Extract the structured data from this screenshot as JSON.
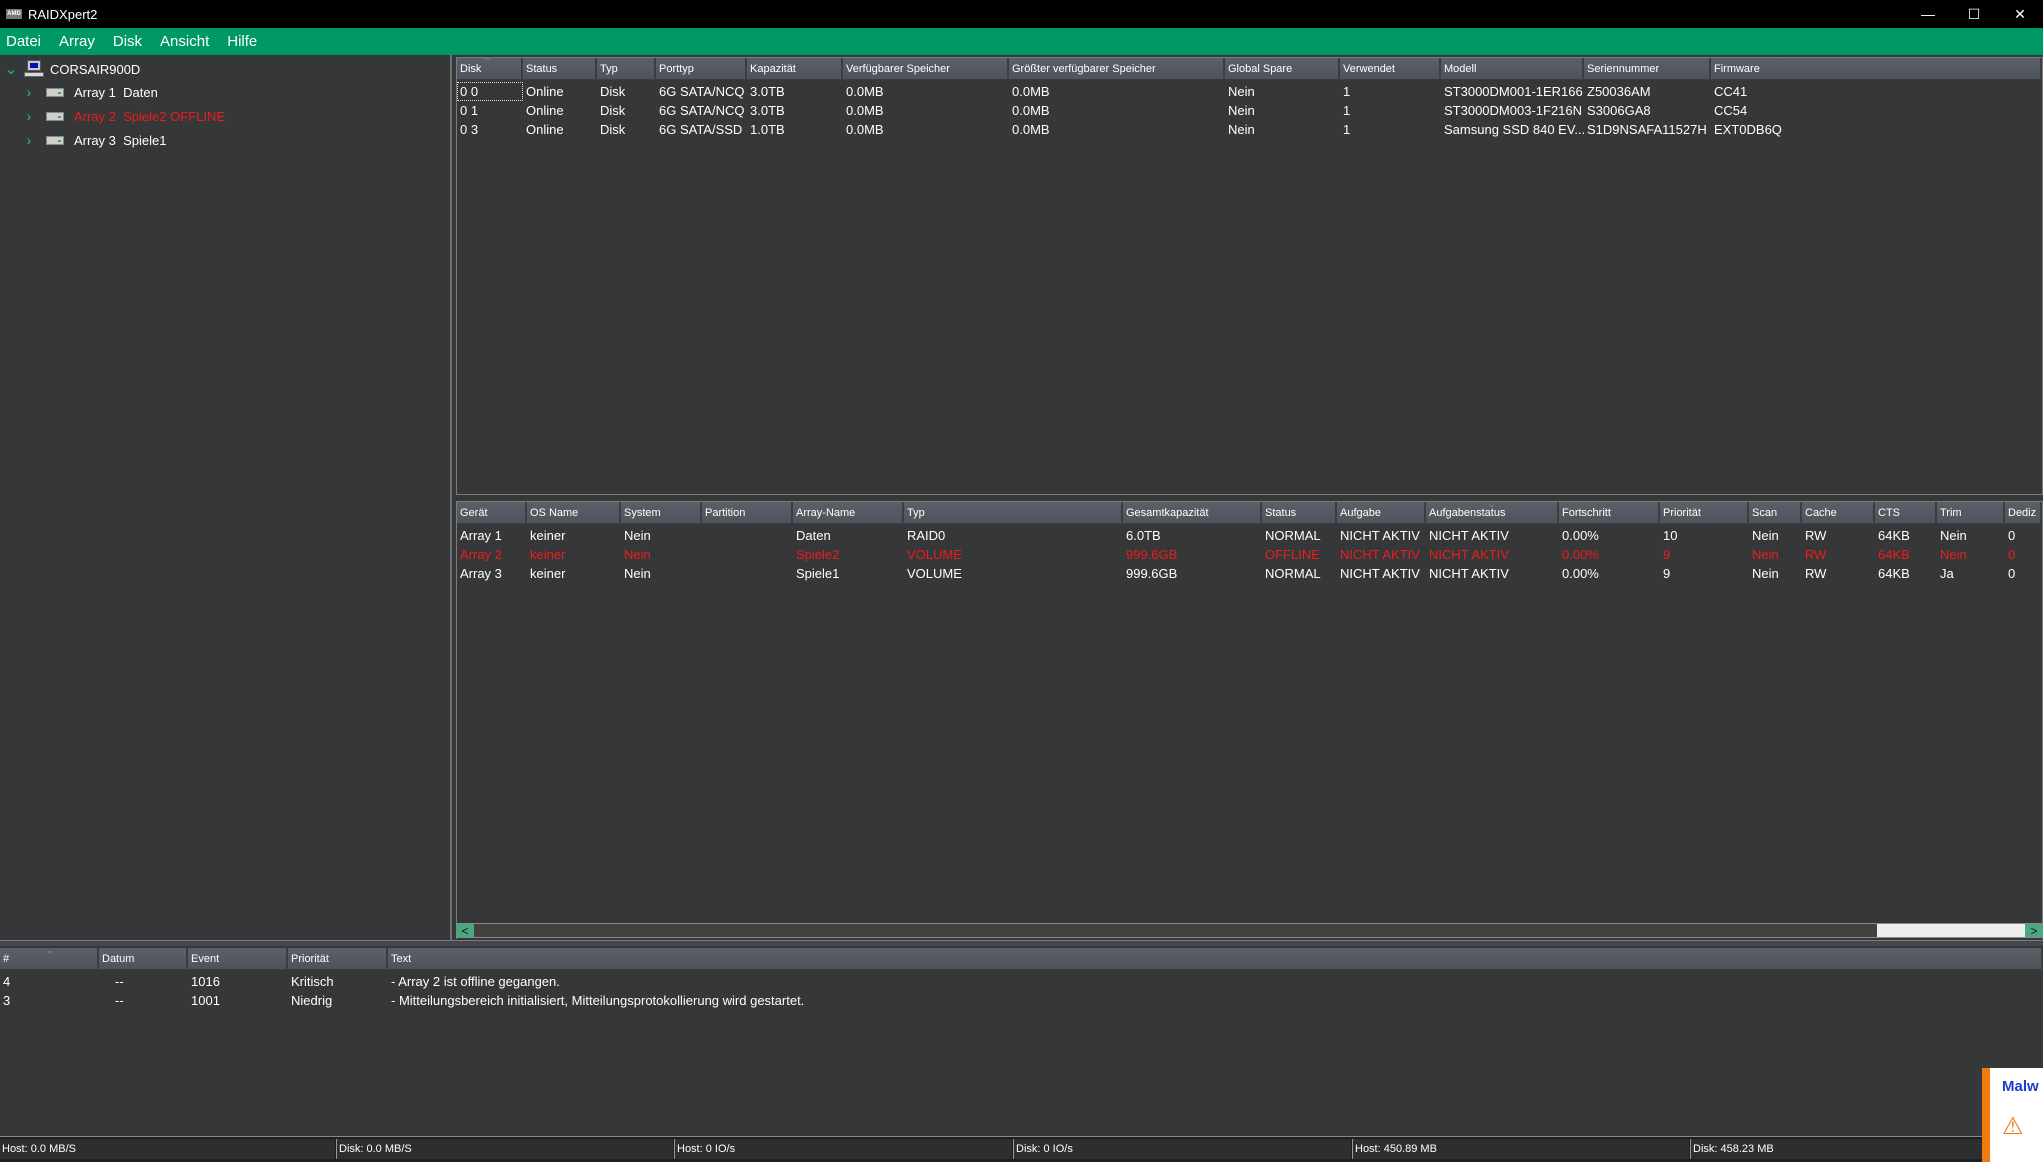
{
  "window": {
    "logo": "AMD",
    "title": "RAIDXpert2",
    "controls": {
      "minimize": "—",
      "maximize": "☐",
      "close": "✕"
    }
  },
  "menu": [
    "Datei",
    "Array",
    "Disk",
    "Ansicht",
    "Hilfe"
  ],
  "tree": {
    "root": {
      "label": "CORSAIR900D",
      "icon": "computer-icon",
      "expanded": true
    },
    "children": [
      {
        "label": "Array 1  Daten",
        "icon": "drive-icon",
        "state": "normal"
      },
      {
        "label": "Array 2  Spiele2 OFFLINE",
        "icon": "drive-icon",
        "state": "offline"
      },
      {
        "label": "Array 3  Spiele1",
        "icon": "drive-icon",
        "state": "normal"
      }
    ]
  },
  "colors": {
    "accent": "#009966",
    "error": "#ee1c1c",
    "background": "#363739",
    "header": "#545962",
    "toast_accent": "#f07a10"
  },
  "disk_table": {
    "columns": [
      "Disk",
      "Status",
      "Typ",
      "Porttyp",
      "Kapazität",
      "Verfügbarer Speicher",
      "Größter verfügbarer Speicher",
      "Global Spare",
      "Verwendet",
      "Modell",
      "Seriennummer",
      "Firmware"
    ],
    "rows": [
      [
        "0 0",
        "Online",
        "Disk",
        "6G SATA/NCQ",
        "3.0TB",
        "0.0MB",
        "0.0MB",
        "Nein",
        "1",
        "ST3000DM001-1ER166",
        "Z50036AM",
        "CC41"
      ],
      [
        "0 1",
        "Online",
        "Disk",
        "6G SATA/NCQ",
        "3.0TB",
        "0.0MB",
        "0.0MB",
        "Nein",
        "1",
        "ST3000DM003-1F216N",
        "S3006GA8",
        "CC54"
      ],
      [
        "0 3",
        "Online",
        "Disk",
        "6G SATA/SSD",
        "1.0TB",
        "0.0MB",
        "0.0MB",
        "Nein",
        "1",
        "Samsung SSD 840 EV...",
        "S1D9NSAFA11527H",
        "EXT0DB6Q"
      ]
    ]
  },
  "array_table": {
    "columns": [
      "Gerät",
      "OS Name",
      "System",
      "Partition",
      "Array-Name",
      "Typ",
      "Gesamtkapazität",
      "Status",
      "Aufgabe",
      "Aufgabenstatus",
      "Fortschritt",
      "Priorität",
      "Scan",
      "Cache",
      "CTS",
      "Trim",
      "Dediz"
    ],
    "rows": [
      {
        "state": "normal",
        "cells": [
          "Array 1",
          "keiner",
          "Nein",
          "",
          "Daten",
          "RAID0",
          "6.0TB",
          "NORMAL",
          "NICHT AKTIV",
          "NICHT AKTIV",
          "0.00%",
          "10",
          "Nein",
          "RW",
          "64KB",
          "Nein",
          "0"
        ]
      },
      {
        "state": "offline",
        "cells": [
          "Array 2",
          "keiner",
          "Nein",
          "",
          "Spiele2",
          "VOLUME",
          "999.6GB",
          "OFFLINE",
          "NICHT AKTIV",
          "NICHT AKTIV",
          "0.00%",
          "9",
          "Nein",
          "RW",
          "64KB",
          "Nein",
          "0"
        ]
      },
      {
        "state": "normal",
        "cells": [
          "Array 3",
          "keiner",
          "Nein",
          "",
          "Spiele1",
          "VOLUME",
          "999.6GB",
          "NORMAL",
          "NICHT AKTIV",
          "NICHT AKTIV",
          "0.00%",
          "9",
          "Nein",
          "RW",
          "64KB",
          "Ja",
          "0"
        ]
      }
    ],
    "scroll": {
      "left": "<",
      "right": ">"
    }
  },
  "event_log": {
    "columns": [
      "#",
      "Datum",
      "Event",
      "Priorität",
      "Text"
    ],
    "rows": [
      [
        "4",
        "--",
        "1016",
        "Kritisch",
        "- Array 2 ist offline gegangen."
      ],
      [
        "3",
        "--",
        "1001",
        "Niedrig",
        "- Mitteilungsbereich initialisiert, Mitteilungsprotokollierung wird gestartet."
      ]
    ]
  },
  "statusbar": [
    "Host: 0.0 MB/S",
    "Disk: 0.0 MB/S",
    "Host: 0 IO/s",
    "Disk: 0 IO/s",
    "Host: 450.89 MB",
    "Disk: 458.23 MB"
  ],
  "toast": {
    "brand": "Malw",
    "icon": "warning-icon"
  }
}
